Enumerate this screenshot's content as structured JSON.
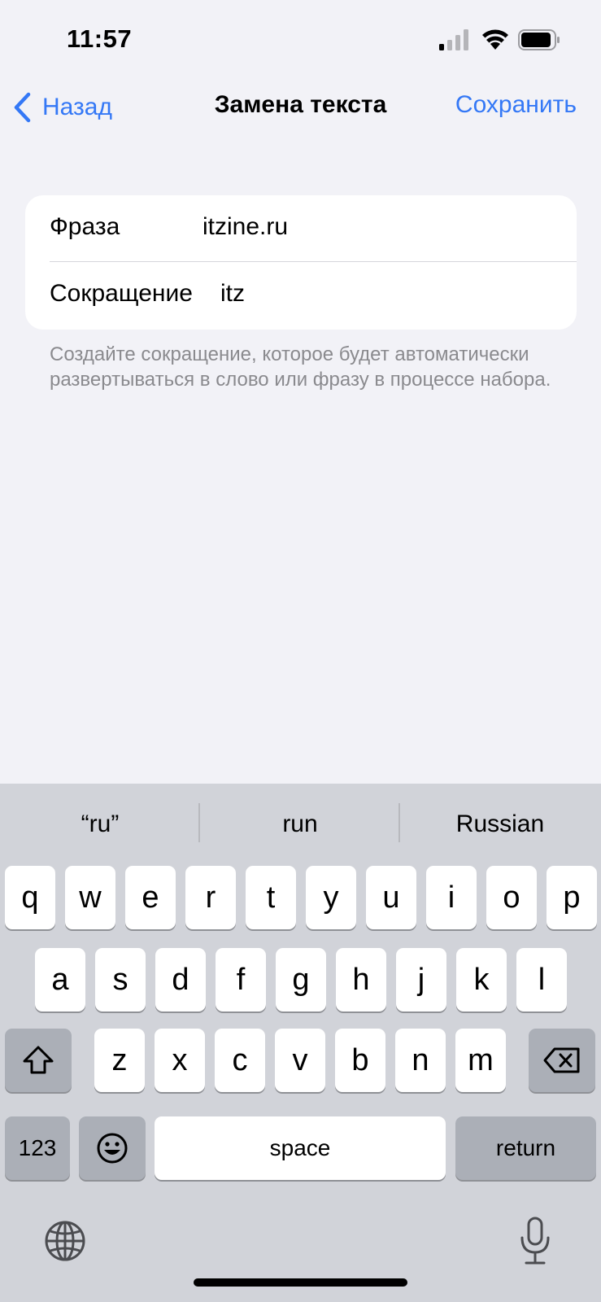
{
  "status_bar": {
    "time": "11:57"
  },
  "nav": {
    "back_label": "Назад",
    "title": "Замена текста",
    "save_label": "Сохранить"
  },
  "form": {
    "phrase_label": "Фраза",
    "phrase_value": "itzine.ru",
    "shortcut_label": "Сокращение",
    "shortcut_value": "itz"
  },
  "hint": "Создайте сокращение, которое будет автоматически развертываться в слово или фразу в процессе набора.",
  "keyboard": {
    "suggestions": [
      "“ru”",
      "run",
      "Russian"
    ],
    "row1": [
      "q",
      "w",
      "e",
      "r",
      "t",
      "y",
      "u",
      "i",
      "o",
      "p"
    ],
    "row2": [
      "a",
      "s",
      "d",
      "f",
      "g",
      "h",
      "j",
      "k",
      "l"
    ],
    "row3": [
      "z",
      "x",
      "c",
      "v",
      "b",
      "n",
      "m"
    ],
    "numbers_label": "123",
    "space_label": "space",
    "return_label": "return"
  },
  "colors": {
    "accent": "#3478f6",
    "background": "#f2f2f7",
    "keyboard_bg": "#d1d3d9"
  }
}
